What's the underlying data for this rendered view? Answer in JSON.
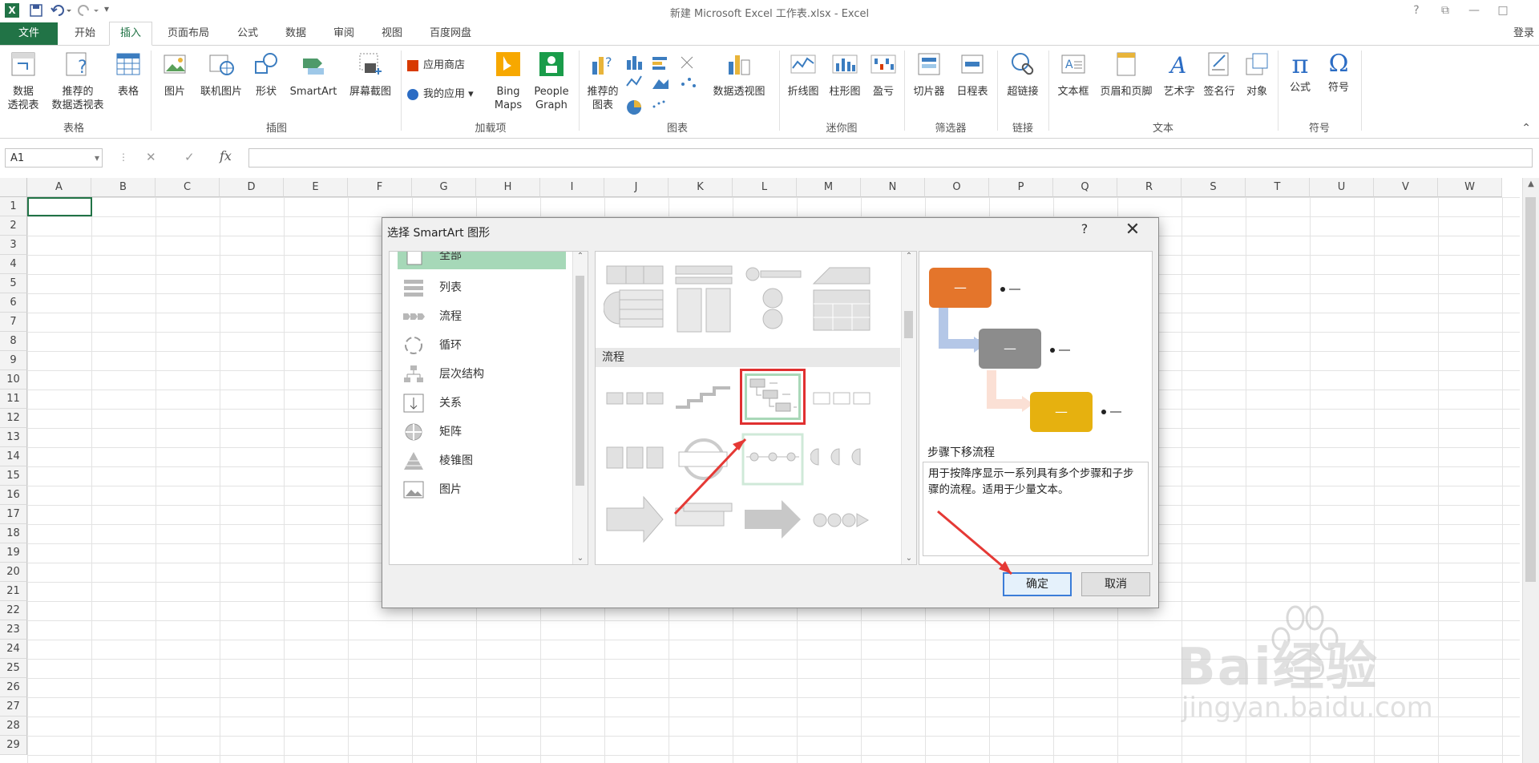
{
  "app": {
    "title": "新建 Microsoft Excel 工作表.xlsx - Excel",
    "login": "登录",
    "window_buttons": [
      "?",
      "⧉",
      "—",
      "□"
    ]
  },
  "tabs": [
    "文件",
    "开始",
    "插入",
    "页面布局",
    "公式",
    "数据",
    "审阅",
    "视图",
    "百度网盘"
  ],
  "ribbon": {
    "tables": {
      "pivot": "数据\n透视表",
      "recommended_pivot": "推荐的\n数据透视表",
      "table": "表格",
      "group": "表格"
    },
    "illustrations": {
      "picture": "图片",
      "online_picture": "联机图片",
      "shapes": "形状",
      "smartart": "SmartArt",
      "screenshot": "屏幕截图",
      "group": "插图"
    },
    "addins": {
      "store": "应用商店",
      "my_apps": "我的应用",
      "bing_maps": "Bing\nMaps",
      "people_graph": "People\nGraph",
      "group": "加载项"
    },
    "charts": {
      "recommended": "推荐的\n图表",
      "pivot_chart": "数据透视图",
      "group": "图表"
    },
    "sparklines": {
      "line": "折线图",
      "column": "柱形图",
      "winloss": "盈亏",
      "group": "迷你图"
    },
    "filters": {
      "slicer": "切片器",
      "timeline": "日程表",
      "group": "筛选器"
    },
    "links": {
      "hyperlink": "超链接",
      "group": "链接"
    },
    "text": {
      "textbox": "文本框",
      "header_footer": "页眉和页脚",
      "wordart": "艺术字",
      "signature": "签名行",
      "object": "对象",
      "group": "文本"
    },
    "symbols": {
      "equation": "公式",
      "symbol": "符号",
      "group": "符号"
    }
  },
  "formula_bar": {
    "name_box": "A1",
    "fx": "fx",
    "cancel": "✕",
    "enter": "✓"
  },
  "sheet": {
    "columns": [
      "A",
      "B",
      "C",
      "D",
      "E",
      "F",
      "G",
      "H",
      "I",
      "J",
      "K",
      "L",
      "M",
      "N",
      "O",
      "P",
      "Q",
      "R",
      "S",
      "T",
      "U",
      "V",
      "W"
    ],
    "rows": [
      "1",
      "2",
      "3",
      "4",
      "5",
      "6",
      "7",
      "8",
      "9",
      "10",
      "11",
      "12",
      "13",
      "14",
      "15",
      "16",
      "17",
      "18",
      "19",
      "20",
      "21",
      "22",
      "23",
      "24",
      "25",
      "26",
      "27",
      "28",
      "29"
    ]
  },
  "dialog": {
    "title": "选择 SmartArt 图形",
    "help": "?",
    "close": "✕",
    "categories": [
      "全部",
      "列表",
      "流程",
      "循环",
      "层次结构",
      "关系",
      "矩阵",
      "棱锥图",
      "图片"
    ],
    "section_label": "流程",
    "preview_name": "步骤下移流程",
    "preview_desc": "用于按降序显示一系列具有多个步骤和子步骤的流程。适用于少量文本。",
    "ok": "确定",
    "cancel": "取消",
    "colors": {
      "orange": "#E4752B",
      "gray": "#8C8C8C",
      "gold": "#E6B10F",
      "selected_border": "#E03030",
      "selected_fill": "#A9D8B8"
    }
  },
  "watermark": {
    "brand": "Bai经验",
    "url": "jingyan.baidu.com"
  }
}
